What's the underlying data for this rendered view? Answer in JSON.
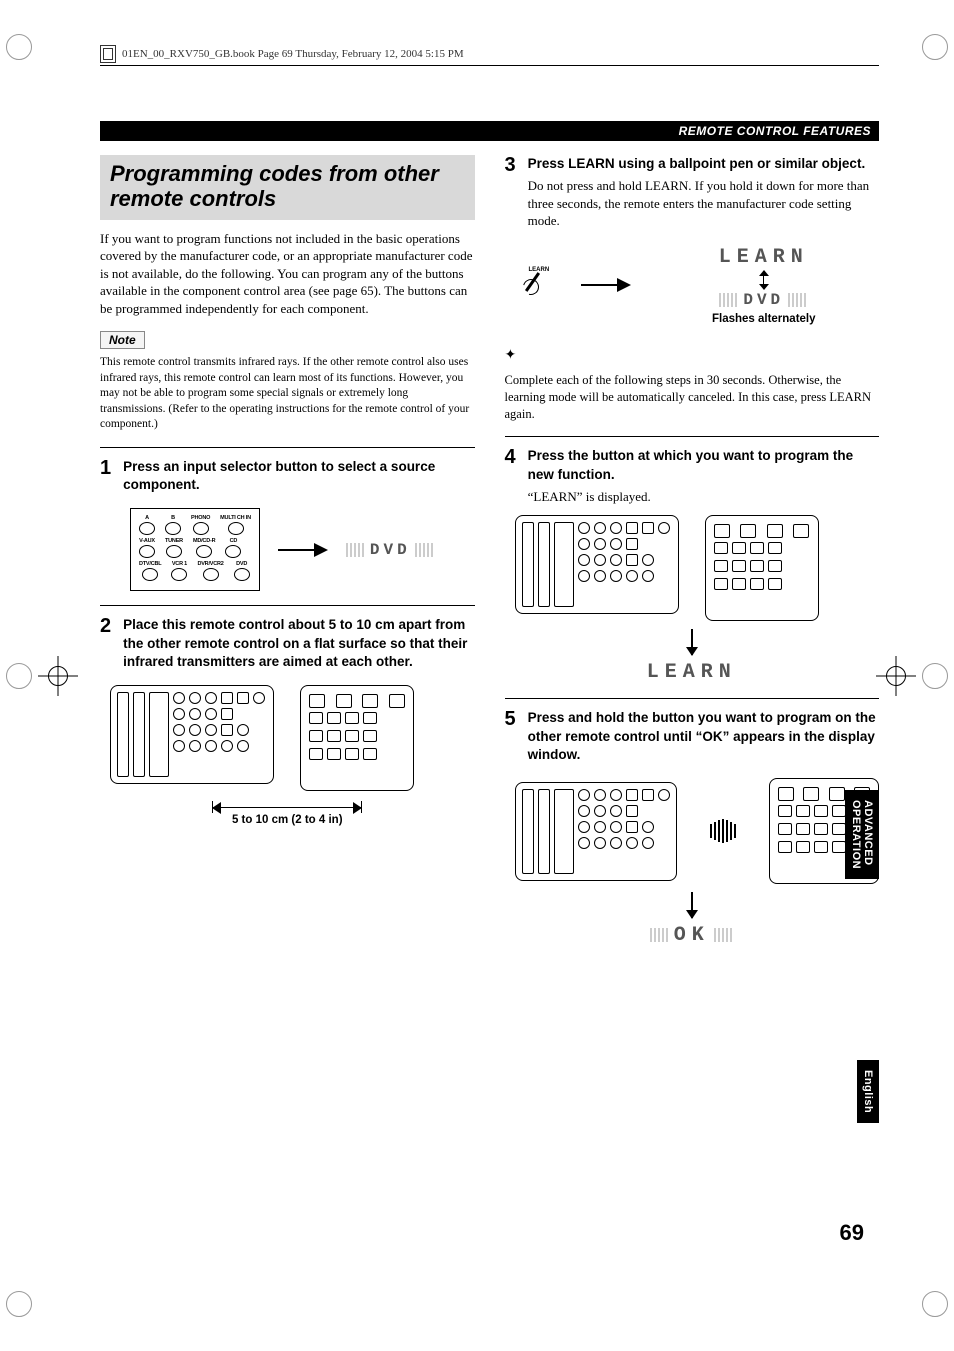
{
  "header": {
    "filename_line": "01EN_00_RXV750_GB.book  Page 69  Thursday, February 12, 2004  5:15 PM"
  },
  "section_bar": "REMOTE CONTROL FEATURES",
  "title": "Programming codes from other remote controls",
  "intro": "If you want to program functions not included in the basic operations covered by the manufacturer code, or an appropriate manufacturer code is not available, do the following. You can program any of the buttons available in the component control area (see page 65). The buttons can be programmed independently for each component.",
  "note_label": "Note",
  "note_text": "This remote control transmits infrared rays. If the other remote control also uses infrared rays, this remote control can learn most of its functions. However, you may not be able to program some special signals or extremely long transmissions. (Refer to the operating instructions for the remote control of your component.)",
  "selector": {
    "row1": [
      "A",
      "B",
      "PHONO",
      "MULTI CH IN"
    ],
    "row2": [
      "V-AUX",
      "TUNER",
      "MD/CD-R",
      "CD"
    ],
    "row3": [
      "DTV/CBL",
      "VCR 1",
      "DVR/VCR2",
      "DVD"
    ]
  },
  "steps": {
    "s1": {
      "num": "1",
      "lead": "Press an input selector button to select a source component.",
      "display": "DVD"
    },
    "s2": {
      "num": "2",
      "lead": "Place this remote control about 5 to 10 cm apart from the other remote control on a flat surface so that their infrared transmitters are aimed at each other.",
      "dim_label": "5 to 10 cm (2 to 4 in)"
    },
    "s3": {
      "num": "3",
      "lead": "Press LEARN using a ballpoint pen or similar object.",
      "follow": "Do not press and hold LEARN. If you hold it down for more than three seconds, the remote enters the manufacturer code setting mode.",
      "pen_label": "LEARN",
      "display_top": "LEARN",
      "display_bottom": "DVD",
      "caption": "Flashes alternately"
    },
    "hint": "Complete each of the following steps in 30 seconds. Otherwise, the learning mode will be automatically canceled. In this case, press LEARN again.",
    "s4": {
      "num": "4",
      "lead": "Press the button at which you want to program the new function.",
      "follow": "“LEARN” is displayed.",
      "display": "LEARN"
    },
    "s5": {
      "num": "5",
      "lead": "Press and hold the button you want to program on the other remote control until “OK” appears in the display window.",
      "display": "OK"
    }
  },
  "side_tab": {
    "line1": "ADVANCED",
    "line2": "OPERATION"
  },
  "side_tab_lang": "English",
  "page_number": "69"
}
